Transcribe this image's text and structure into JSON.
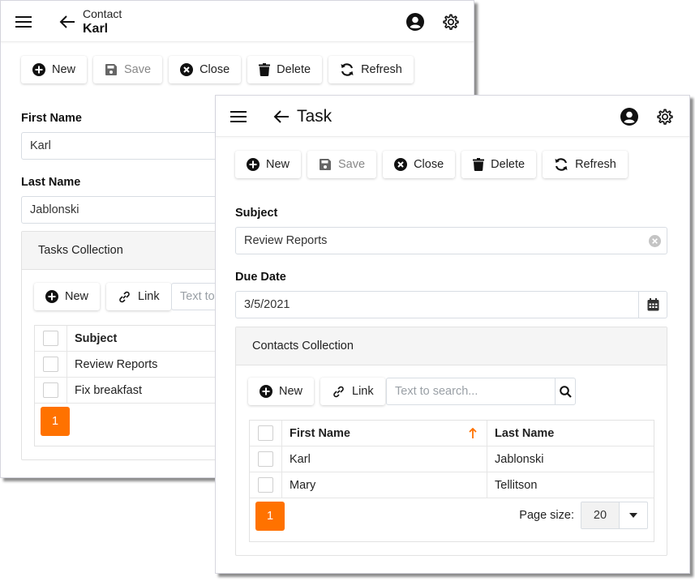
{
  "contact_window": {
    "header": {
      "entity_type": "Contact",
      "entity_name": "Karl"
    },
    "toolbar": {
      "new": "New",
      "save": "Save",
      "close": "Close",
      "delete": "Delete",
      "refresh": "Refresh"
    },
    "fields": {
      "first_name": {
        "label": "First Name",
        "value": "Karl"
      },
      "last_name": {
        "label": "Last Name",
        "value": "Jablonski"
      }
    },
    "tasks_collection": {
      "title": "Tasks Collection",
      "toolbar": {
        "new": "New",
        "link": "Link",
        "search_placeholder": "Text to search..."
      },
      "columns": [
        "Subject"
      ],
      "rows": [
        {
          "subject": "Review Reports"
        },
        {
          "subject": "Fix breakfast"
        }
      ],
      "pager": {
        "current_page": "1"
      }
    }
  },
  "task_window": {
    "header": {
      "title": "Task"
    },
    "toolbar": {
      "new": "New",
      "save": "Save",
      "close": "Close",
      "delete": "Delete",
      "refresh": "Refresh"
    },
    "fields": {
      "subject": {
        "label": "Subject",
        "value": "Review Reports"
      },
      "due_date": {
        "label": "Due Date",
        "value": "3/5/2021"
      }
    },
    "contacts_collection": {
      "title": "Contacts Collection",
      "toolbar": {
        "new": "New",
        "link": "Link",
        "search_placeholder": "Text to search..."
      },
      "columns": [
        "First Name",
        "Last Name"
      ],
      "sort": {
        "column": "First Name",
        "direction": "ascending"
      },
      "rows": [
        {
          "first_name": "Karl",
          "last_name": "Jablonski"
        },
        {
          "first_name": "Mary",
          "last_name": "Tellitson"
        }
      ],
      "pager": {
        "current_page": "1",
        "page_size_label": "Page size:",
        "page_size": "20"
      }
    }
  },
  "colors": {
    "accent": "#ff7200",
    "sort_arrow": "#ff7200"
  }
}
